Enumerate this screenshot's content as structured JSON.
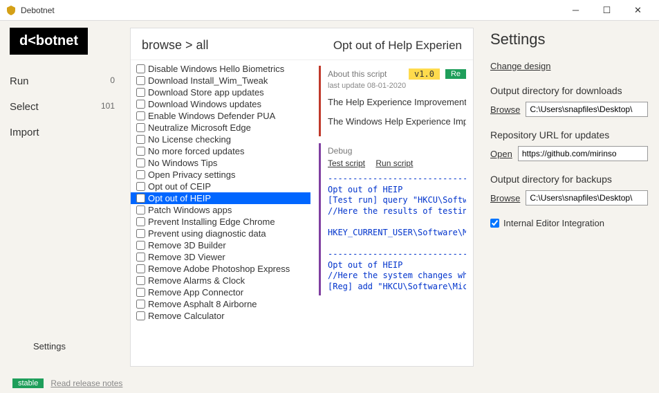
{
  "window": {
    "title": "Debotnet"
  },
  "logo": "d<botnet",
  "nav": {
    "run": {
      "label": "Run",
      "count": "0"
    },
    "select": {
      "label": "Select",
      "count": "101"
    },
    "import": {
      "label": "Import"
    },
    "settings": {
      "label": "Settings"
    }
  },
  "breadcrumb": {
    "left": "browse  >  all",
    "right": "Opt out of Help Experien"
  },
  "scripts": [
    "Disable Windows Hello Biometrics",
    "Download Install_Wim_Tweak",
    "Download Store app updates",
    "Download Windows updates",
    "Enable Windows Defender PUA",
    "Neutralize Microsoft Edge",
    "No License checking",
    "No more forced updates",
    "No Windows Tips",
    "Open Privacy settings",
    "Opt out of CEIP",
    "Opt out of HEIP",
    "Patch Windows apps",
    "Prevent Installing Edge Chrome",
    "Prevent using diagnostic data",
    "Remove 3D Builder",
    "Remove 3D Viewer",
    "Remove Adobe Photoshop Express",
    "Remove Alarms & Clock",
    "Remove App Connector",
    "Remove Asphalt 8 Airborne",
    "Remove Calculator"
  ],
  "selected_index": 11,
  "about": {
    "head": "About this script",
    "version": "v1.0",
    "green": "Re",
    "updated": "last update 08-01-2020",
    "p1": "The Help Experience Improvement to Microsoft information about how might reveal what problems you are",
    "p2": "The Windows Help Experience Impr disabled with this script."
  },
  "debug": {
    "head": "Debug",
    "link1": "Test script",
    "link2": "Run script",
    "out": "-------------------------------\nOpt out of HEIP\n[Test run] query \"HKCU\\Software\\\n//Here the results of testing\n\nHKEY_CURRENT_USER\\Software\\Micro\n\n-------------------------------\nOpt out of HEIP\n//Here the system changes which\n[Reg] add \"HKCU\\Software\\Microso"
  },
  "settings": {
    "title": "Settings",
    "change_design": "Change design",
    "out_dl_label": "Output directory for downloads",
    "out_dl_val": "C:\\Users\\snapfiles\\Desktop\\",
    "repo_label": "Repository URL for updates",
    "repo_val": "https://github.com/mirinso",
    "out_bk_label": "Output directory for backups",
    "out_bk_val": "C:\\Users\\snapfiles\\Desktop\\",
    "browse": "Browse",
    "open": "Open",
    "editor_chk": "Internal Editor Integration"
  },
  "status": {
    "stable": "stable",
    "notes": "Read release notes"
  }
}
